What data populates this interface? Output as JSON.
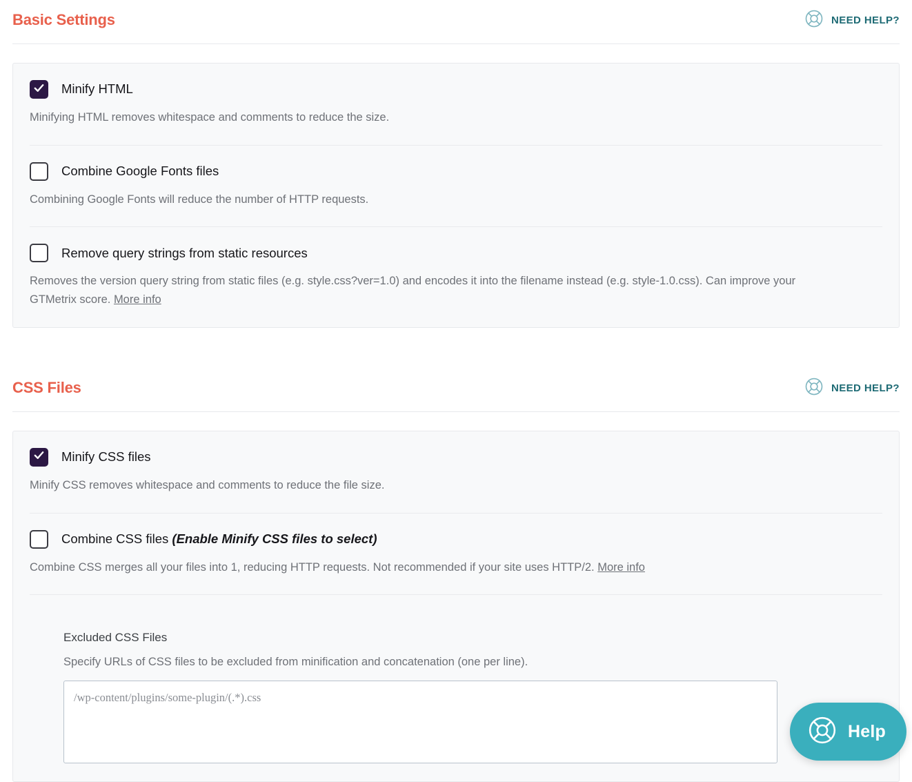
{
  "theme": {
    "heading_color": "#e8604c",
    "need_help_color": "#1d6a74",
    "checkbox_checked_color": "#2c1844",
    "help_widget_color": "#3aafbd",
    "card_background": "#f8f9fa",
    "description_color": "#6e7177"
  },
  "sections": [
    {
      "title": "Basic Settings",
      "need_help_label": "NEED HELP?",
      "need_help_icon": "lifebuoy-icon",
      "rows": [
        {
          "name": "minify-html",
          "checked": true,
          "label": "Minify HTML",
          "label_hint": "",
          "description": "Minifying HTML removes whitespace and comments to reduce the size.",
          "link_text": ""
        },
        {
          "name": "combine-google-fonts-files",
          "checked": false,
          "label": "Combine Google Fonts files",
          "label_hint": "",
          "description": "Combining Google Fonts will reduce the number of HTTP requests.",
          "link_text": ""
        },
        {
          "name": "remove-query-strings",
          "checked": false,
          "label": "Remove query strings from static resources",
          "label_hint": "",
          "description": "Removes the version query string from static files (e.g. style.css?ver=1.0) and encodes it into the filename instead (e.g. style-1.0.css). Can improve your GTMetrix score. ",
          "link_text": "More info"
        }
      ]
    },
    {
      "title": "CSS Files",
      "need_help_label": "NEED HELP?",
      "need_help_icon": "lifebuoy-icon",
      "rows": [
        {
          "name": "minify-css-files",
          "checked": true,
          "label": "Minify CSS files",
          "label_hint": "",
          "description": "Minify CSS removes whitespace and comments to reduce the file size.",
          "link_text": ""
        },
        {
          "name": "combine-css-files",
          "checked": false,
          "label": "Combine CSS files ",
          "label_hint": "(Enable Minify CSS files to select)",
          "description": "Combine CSS merges all your files into 1, reducing HTTP requests. Not recommended if your site uses HTTP/2. ",
          "link_text": "More info"
        }
      ],
      "field": {
        "name": "excluded-css-files",
        "label": "Excluded CSS Files",
        "description": "Specify URLs of CSS files to be excluded from minification and concatenation (one per line).",
        "placeholder": "/wp-content/plugins/some-plugin/(.*).css",
        "value": ""
      }
    }
  ],
  "help_widget": {
    "label": "Help",
    "icon": "lifebuoy-icon"
  }
}
